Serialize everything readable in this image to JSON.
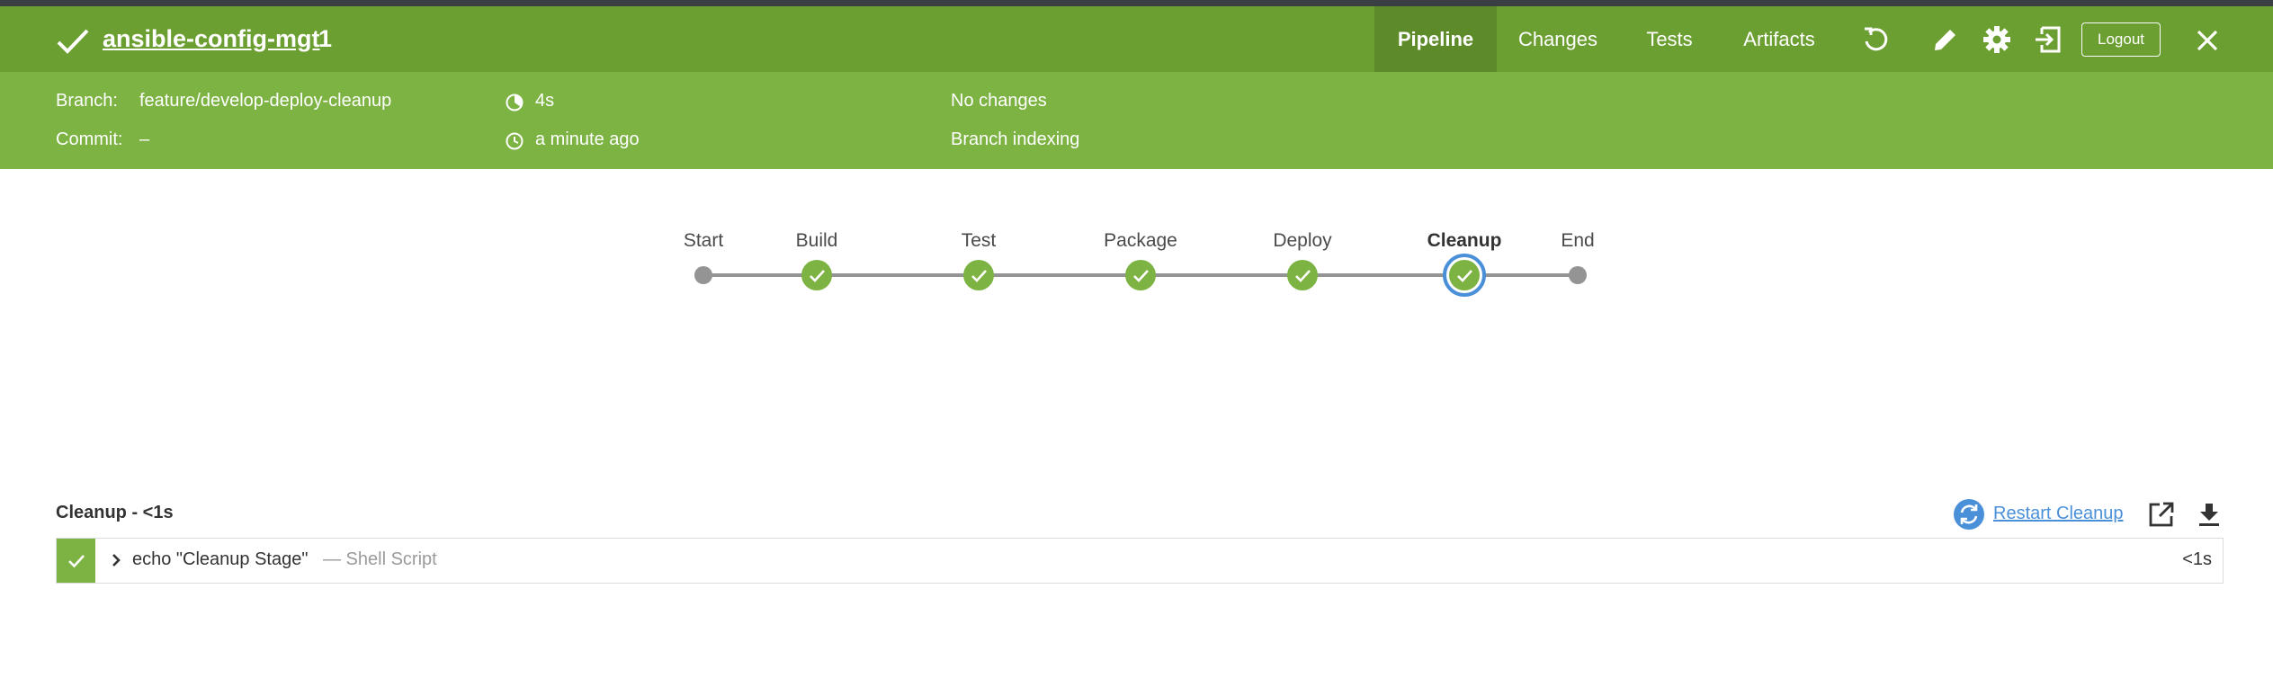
{
  "header": {
    "title": "ansible-config-mgt",
    "run_number": "1",
    "tabs": [
      {
        "label": "Pipeline",
        "active": true
      },
      {
        "label": "Changes",
        "active": false
      },
      {
        "label": "Tests",
        "active": false
      },
      {
        "label": "Artifacts",
        "active": false
      }
    ],
    "icons": [
      "replay-icon",
      "edit-icon",
      "settings-icon",
      "exit-to-classic-icon"
    ],
    "logout_label": "Logout",
    "close_icon": "close-icon"
  },
  "info": {
    "branch_label": "Branch:",
    "branch_value": "feature/develop-deploy-cleanup",
    "commit_label": "Commit:",
    "commit_value": "–",
    "duration": "4s",
    "time_ago": "a minute ago",
    "changes": "No changes",
    "cause": "Branch indexing"
  },
  "pipeline": {
    "stages": [
      {
        "name": "Start",
        "status": "start",
        "selected": false
      },
      {
        "name": "Build",
        "status": "success",
        "selected": false
      },
      {
        "name": "Test",
        "status": "success",
        "selected": false
      },
      {
        "name": "Package",
        "status": "success",
        "selected": false
      },
      {
        "name": "Deploy",
        "status": "success",
        "selected": false
      },
      {
        "name": "Cleanup",
        "status": "success",
        "selected": true
      },
      {
        "name": "End",
        "status": "end",
        "selected": false
      }
    ]
  },
  "steps": {
    "title": "Cleanup - <1s",
    "restart_label": "Restart Cleanup",
    "items": [
      {
        "command": "echo \"Cleanup Stage\"",
        "type": "— Shell Script",
        "duration": "<1s",
        "status": "success"
      }
    ]
  },
  "colors": {
    "header_bg": "#6c9f31",
    "info_bg": "#7cb342",
    "success": "#7cb342",
    "selected_ring": "#4a90d9",
    "link": "#4a90d9",
    "node_gray": "#949494"
  }
}
